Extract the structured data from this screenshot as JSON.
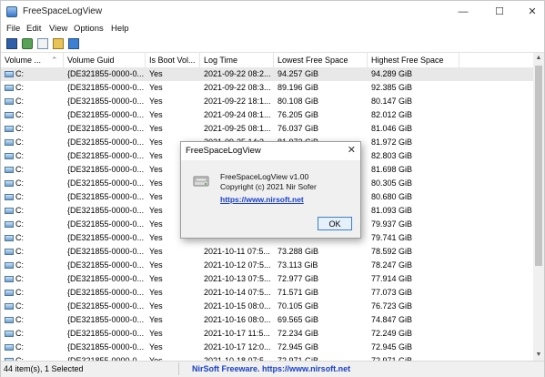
{
  "window": {
    "title": "FreeSpaceLogView",
    "minimize": "—",
    "maximize": "☐",
    "close": "✕"
  },
  "menu": [
    "File",
    "Edit",
    "View",
    "Options",
    "Help"
  ],
  "toolbar": [
    "save-icon",
    "refresh-icon",
    "copy-icon",
    "properties-icon",
    "exit-icon"
  ],
  "columns": [
    "Volume ...",
    "Volume Guid",
    "Is Boot Vol...",
    "Log Time",
    "Lowest Free Space",
    "Highest Free Space"
  ],
  "sort_indicator": "⌃",
  "rows": [
    {
      "vol": "C:",
      "guid": "{DE321855-0000-0...",
      "boot": "Yes",
      "time": "2021-09-22 08:2...",
      "low": "94.257 GiB",
      "high": "94.289 GiB",
      "selected": true
    },
    {
      "vol": "C:",
      "guid": "{DE321855-0000-0...",
      "boot": "Yes",
      "time": "2021-09-22 08:3...",
      "low": "89.196 GiB",
      "high": "92.385 GiB"
    },
    {
      "vol": "C:",
      "guid": "{DE321855-0000-0...",
      "boot": "Yes",
      "time": "2021-09-22 18:1...",
      "low": "80.108 GiB",
      "high": "80.147 GiB"
    },
    {
      "vol": "C:",
      "guid": "{DE321855-0000-0...",
      "boot": "Yes",
      "time": "2021-09-24 08:1...",
      "low": "76.205 GiB",
      "high": "82.012 GiB"
    },
    {
      "vol": "C:",
      "guid": "{DE321855-0000-0...",
      "boot": "Yes",
      "time": "2021-09-25 08:1...",
      "low": "76.037 GiB",
      "high": "81.046 GiB"
    },
    {
      "vol": "C:",
      "guid": "{DE321855-0000-0...",
      "boot": "Yes",
      "time": "2021-09-25 14:3...",
      "low": "81.972 GiB",
      "high": "81.972 GiB"
    },
    {
      "vol": "C:",
      "guid": "{DE321855-0000-0...",
      "boot": "Yes",
      "time": "",
      "low": "",
      "high": "82.803 GiB"
    },
    {
      "vol": "C:",
      "guid": "{DE321855-0000-0...",
      "boot": "Yes",
      "time": "",
      "low": "",
      "high": "81.698 GiB"
    },
    {
      "vol": "C:",
      "guid": "{DE321855-0000-0...",
      "boot": "Yes",
      "time": "",
      "low": "",
      "high": "80.305 GiB"
    },
    {
      "vol": "C:",
      "guid": "{DE321855-0000-0...",
      "boot": "Yes",
      "time": "",
      "low": "",
      "high": "80.680 GiB"
    },
    {
      "vol": "C:",
      "guid": "{DE321855-0000-0...",
      "boot": "Yes",
      "time": "",
      "low": "",
      "high": "81.093 GiB"
    },
    {
      "vol": "C:",
      "guid": "{DE321855-0000-0...",
      "boot": "Yes",
      "time": "",
      "low": "",
      "high": "79.937 GiB"
    },
    {
      "vol": "C:",
      "guid": "{DE321855-0000-0...",
      "boot": "Yes",
      "time": "",
      "low": "",
      "high": "79.741 GiB"
    },
    {
      "vol": "C:",
      "guid": "{DE321855-0000-0...",
      "boot": "Yes",
      "time": "2021-10-11 07:5...",
      "low": "73.288 GiB",
      "high": "78.592 GiB"
    },
    {
      "vol": "C:",
      "guid": "{DE321855-0000-0...",
      "boot": "Yes",
      "time": "2021-10-12 07:5...",
      "low": "73.113 GiB",
      "high": "78.247 GiB"
    },
    {
      "vol": "C:",
      "guid": "{DE321855-0000-0...",
      "boot": "Yes",
      "time": "2021-10-13 07:5...",
      "low": "72.977 GiB",
      "high": "77.914 GiB"
    },
    {
      "vol": "C:",
      "guid": "{DE321855-0000-0...",
      "boot": "Yes",
      "time": "2021-10-14 07:5...",
      "low": "71.571 GiB",
      "high": "77.073 GiB"
    },
    {
      "vol": "C:",
      "guid": "{DE321855-0000-0...",
      "boot": "Yes",
      "time": "2021-10-15 08:0...",
      "low": "70.105 GiB",
      "high": "76.723 GiB"
    },
    {
      "vol": "C:",
      "guid": "{DE321855-0000-0...",
      "boot": "Yes",
      "time": "2021-10-16 08:0...",
      "low": "69.565 GiB",
      "high": "74.847 GiB"
    },
    {
      "vol": "C:",
      "guid": "{DE321855-0000-0...",
      "boot": "Yes",
      "time": "2021-10-17 11:5...",
      "low": "72.234 GiB",
      "high": "72.249 GiB"
    },
    {
      "vol": "C:",
      "guid": "{DE321855-0000-0...",
      "boot": "Yes",
      "time": "2021-10-17 12:0...",
      "low": "72.945 GiB",
      "high": "72.945 GiB"
    },
    {
      "vol": "C:",
      "guid": "{DE321855-0000-0...",
      "boot": "Yes",
      "time": "2021-10-18 07:5...",
      "low": "72.971 GiB",
      "high": "72.971 GiB"
    }
  ],
  "status": {
    "items": "44 item(s), 1 Selected",
    "link": "NirSoft Freeware. https://www.nirsoft.net"
  },
  "dialog": {
    "title": "FreeSpaceLogView",
    "close": "✕",
    "line1": "FreeSpaceLogView v1.00",
    "line2": "Copyright (c) 2021 Nir Sofer",
    "link": "https://www.nirsoft.net",
    "ok": "OK"
  },
  "colors": {
    "link": "#1a3fd0",
    "selected_row": "#e8e8e8",
    "ok_border": "#3c7fd6"
  }
}
